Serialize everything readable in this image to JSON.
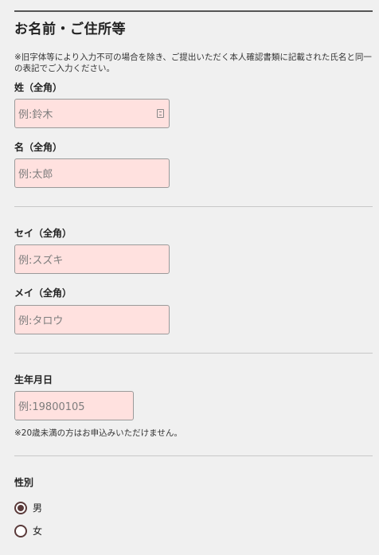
{
  "section": {
    "title": "お名前・ご住所等",
    "notice": "※旧字体等により入力不可の場合を除き、ご提出いただく本人確認書類に記載された氏名と同一の表記でご入力ください。"
  },
  "fields": {
    "last_name": {
      "label": "姓（全角）",
      "placeholder": "例:鈴木"
    },
    "first_name": {
      "label": "名（全角）",
      "placeholder": "例:太郎"
    },
    "last_name_kana": {
      "label": "セイ（全角）",
      "placeholder": "例:スズキ"
    },
    "first_name_kana": {
      "label": "メイ（全角）",
      "placeholder": "例:タロウ"
    },
    "birthdate": {
      "label": "生年月日",
      "placeholder": "例:19800105",
      "note": "※20歳未満の方はお申込みいただけません。"
    },
    "gender": {
      "label": "性別",
      "options": [
        "男",
        "女"
      ],
      "selected": "男"
    }
  },
  "icons": {
    "keyboard_icon": "keyboard-icon"
  },
  "colors": {
    "input_background": "#ffe1df",
    "radio_accent": "#5a3a3a",
    "page_background": "#f0f0f0"
  }
}
